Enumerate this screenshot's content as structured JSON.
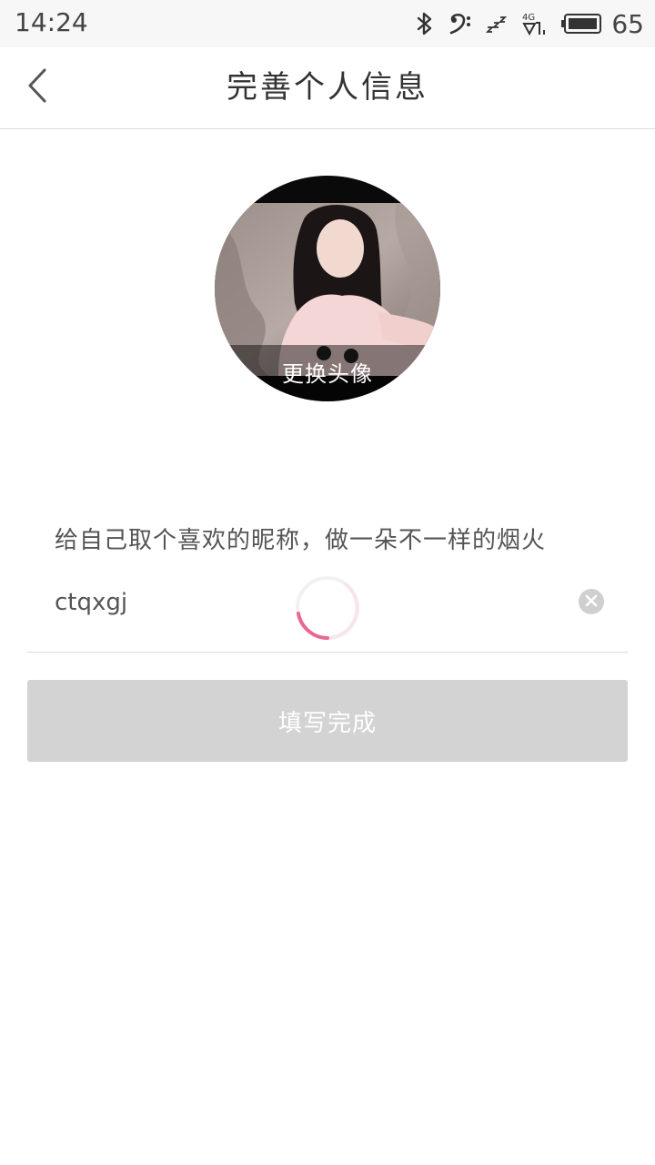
{
  "status_bar": {
    "time": "14:24",
    "icons": [
      "bluetooth-icon",
      "bass-clef-icon",
      "sleep-icon",
      "signal-4g-icon",
      "battery-icon"
    ],
    "network_label": "4G",
    "battery_level": "65"
  },
  "header": {
    "back_icon": "chevron-left-icon",
    "title": "完善个人信息"
  },
  "avatar": {
    "change_label": "更换头像"
  },
  "nickname": {
    "hint": "给自己取个喜欢的昵称，做一朵不一样的烟火",
    "value": "ctqxgj",
    "clear_icon": "clear-icon"
  },
  "submit": {
    "label": "填写完成",
    "disabled_color": "#d3d3d3"
  },
  "colors": {
    "spinner": "#e8698f",
    "title_text": "#333333",
    "hint_text": "#555555"
  }
}
